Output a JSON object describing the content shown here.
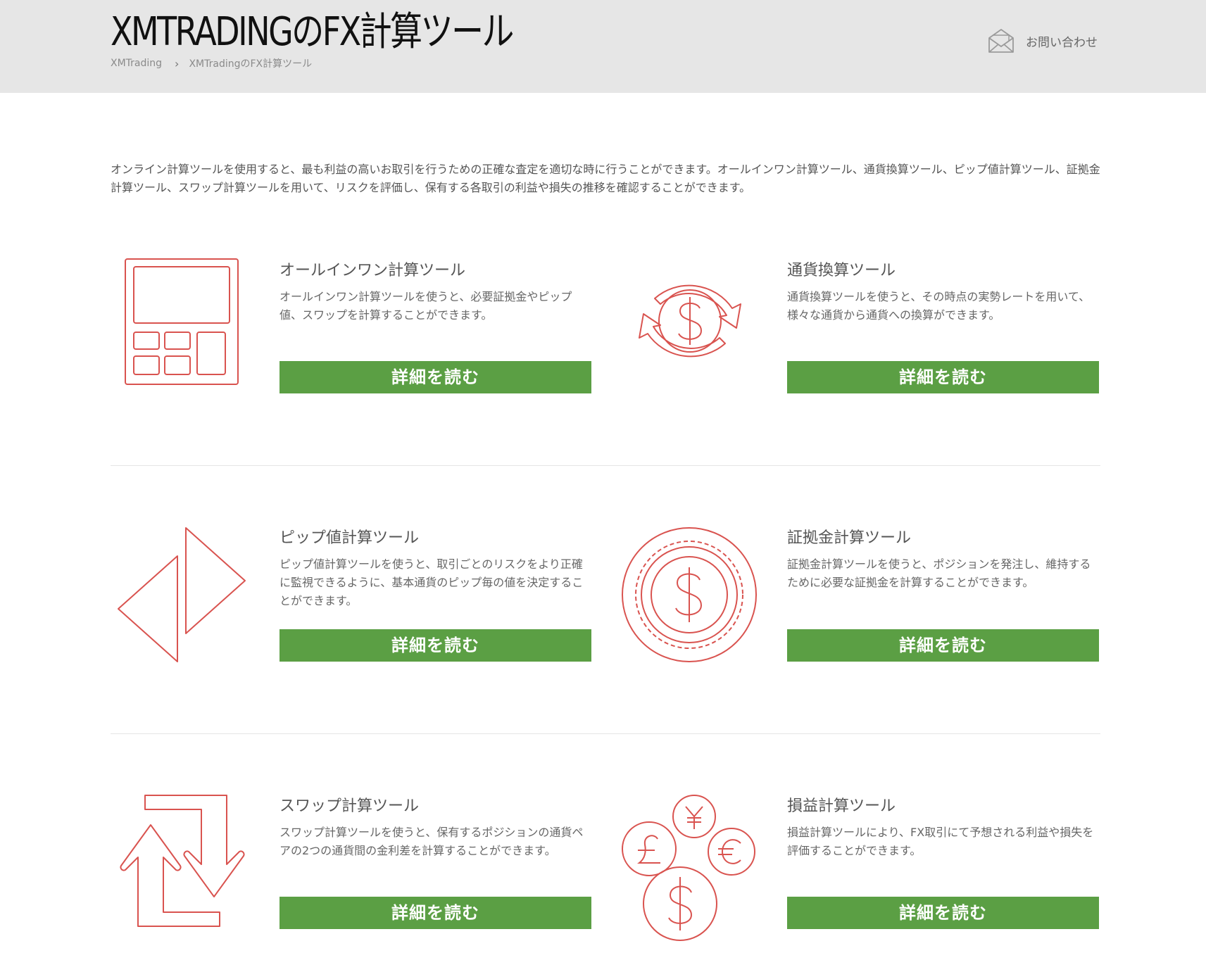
{
  "header": {
    "title": "XMTRADINGのFX計算ツール",
    "breadcrumb": [
      {
        "label": "XMTrading"
      },
      {
        "label": "XMTradingのFX計算ツール"
      }
    ],
    "contact_label": "お問い合わせ",
    "contact_icon": "envelope-icon"
  },
  "intro": "オンライン計算ツールを使用すると、最も利益の高いお取引を行うための正確な査定を適切な時に行うことができます。オールインワン計算ツール、通貨換算ツール、ピップ値計算ツール、証拠金計算ツール、スワップ計算ツールを用いて、リスクを評価し、保有する各取引の利益や損失の推移を確認することができます。",
  "accent_color": "#d9534f",
  "button_color": "#5b9f44",
  "tools": [
    {
      "icon": "calculator-icon",
      "title": "オールインワン計算ツール",
      "desc": "オールインワン計算ツールを使うと、必要証拠金やピップ値、スワップを計算することができます。",
      "button": "詳細を読む"
    },
    {
      "icon": "currency-exchange-icon",
      "title": "通貨換算ツール",
      "desc": "通貨換算ツールを使うと、その時点の実勢レートを用いて、様々な通貨から通貨への換算ができます。",
      "button": "詳細を読む"
    },
    {
      "icon": "pip-arrows-icon",
      "title": "ピップ値計算ツール",
      "desc": "ピップ値計算ツールを使うと、取引ごとのリスクをより正確に監視できるように、基本通貨のピップ毎の値を決定することができます。",
      "button": "詳細を読む"
    },
    {
      "icon": "dollar-coin-icon",
      "title": "証拠金計算ツール",
      "desc": "証拠金計算ツールを使うと、ポジションを発注し、維持するために必要な証拠金を計算することができます。",
      "button": "詳細を読む"
    },
    {
      "icon": "swap-arrows-icon",
      "title": "スワップ計算ツール",
      "desc": "スワップ計算ツールを使うと、保有するポジションの通貨ペアの2つの通貨間の金利差を計算することができます。",
      "button": "詳細を読む"
    },
    {
      "icon": "currency-coins-icon",
      "title": "損益計算ツール",
      "desc": "損益計算ツールにより、FX取引にて予想される利益や損失を評価することができます。",
      "button": "詳細を読む"
    }
  ]
}
